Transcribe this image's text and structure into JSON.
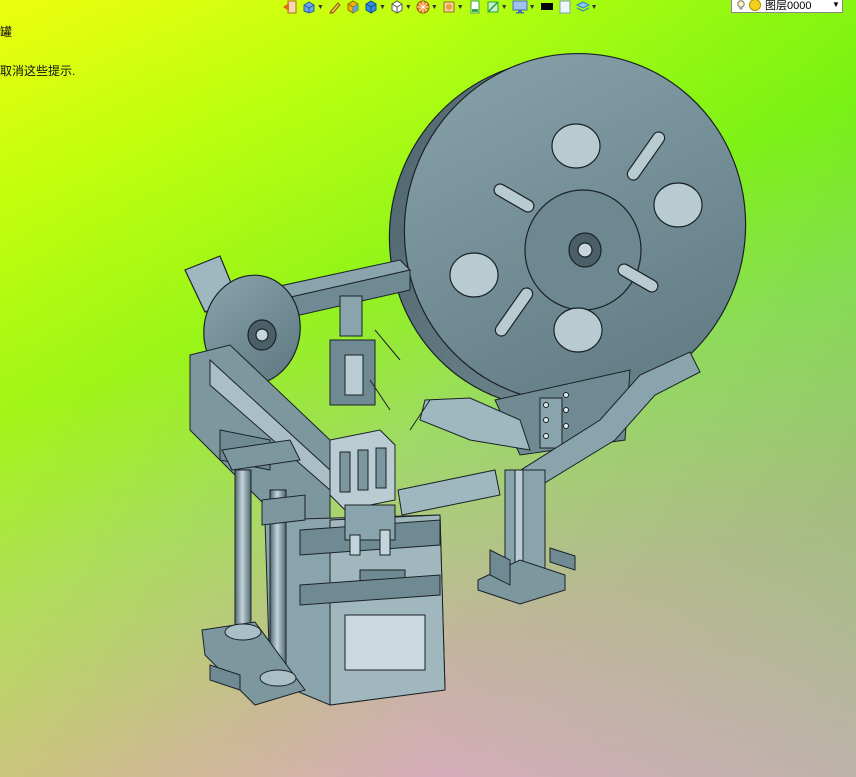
{
  "hint": {
    "line1": "罐",
    "line2": "取消这些提示."
  },
  "toolbar": {
    "items": [
      {
        "name": "exit-icon",
        "color": "#e36a18"
      },
      {
        "name": "view-orient-icon",
        "color": "#3b78c7"
      },
      {
        "name": "pencil-icon",
        "color": "#d03a2a"
      },
      {
        "name": "shaded-cube-icon",
        "color": "#f4b400"
      },
      {
        "name": "box-blue-icon",
        "color": "#2f8ee0"
      },
      {
        "name": "cube-white-icon",
        "color": "#ffffff"
      },
      {
        "name": "render-sphere-icon",
        "color": "#f08a1c"
      },
      {
        "name": "appearance-icon",
        "color": "#e8a040"
      },
      {
        "name": "sheet-icon",
        "color": "#3da54a"
      },
      {
        "name": "section-icon",
        "color": "#27a33b"
      },
      {
        "name": "display-monitor-icon",
        "color": "#4a6fb3"
      },
      {
        "name": "color-black-icon",
        "color": "#000000"
      },
      {
        "name": "color-white-icon",
        "color": "#ffffff"
      },
      {
        "name": "layers-icon",
        "color": "#2a7fc7"
      }
    ]
  },
  "layer": {
    "value": "图层0000"
  },
  "colors": {
    "part": "#6f8a93",
    "part_light": "#9fb8c0",
    "part_dark": "#3e5158",
    "edge": "#1a2226"
  }
}
